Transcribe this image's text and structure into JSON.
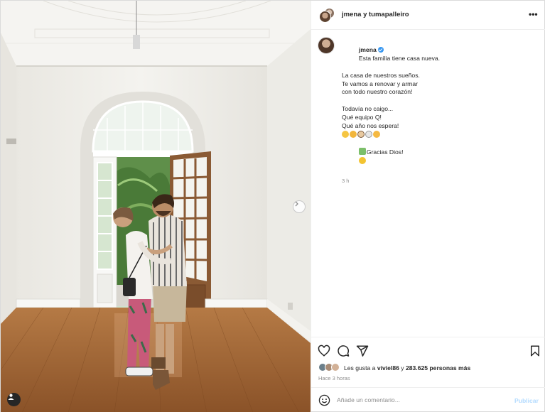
{
  "header": {
    "usernames": "jmena y tumapalleiro",
    "more_icon": "more-horizontal-icon",
    "more_glyph": "•••"
  },
  "caption": {
    "username": "jmena",
    "verified": true,
    "lines": [
      "Esta familia tiene casa nueva.",
      "La casa de nuestros sueños.",
      "Te vamos a renovar y armar",
      "con todo nuestro corazón!",
      "",
      "Todavía no caigo...",
      "Qué equipo Q!",
      "Qué año nos espera!"
    ],
    "emoji_line_1": [
      "pleading-face",
      "smiling-face",
      "face-with-cowboy-hat",
      "face",
      "cat-face"
    ],
    "emoji_line_2_icon": "house-with-garden",
    "emoji_line_2_text": "Gracias Dios!",
    "emoji_line_2_end": "sparkle-bee",
    "timestamp": "3 h"
  },
  "actions": {
    "like_icon": "heart-icon",
    "comment_icon": "comment-icon",
    "share_icon": "paper-plane-icon",
    "save_icon": "bookmark-icon"
  },
  "likes": {
    "prefix": "Les gusta a",
    "user": "viviel86",
    "middle": "y",
    "count": "283.625 personas más"
  },
  "posted_ago": "Hace 3 horas",
  "comment": {
    "placeholder": "Añade un comentario...",
    "publish_label": "Publicar"
  },
  "colors": {
    "accent_blue": "#3897f0",
    "publish_disabled": "#b3dbff",
    "muted_text": "#8e8e8e",
    "border": "#efefef"
  }
}
